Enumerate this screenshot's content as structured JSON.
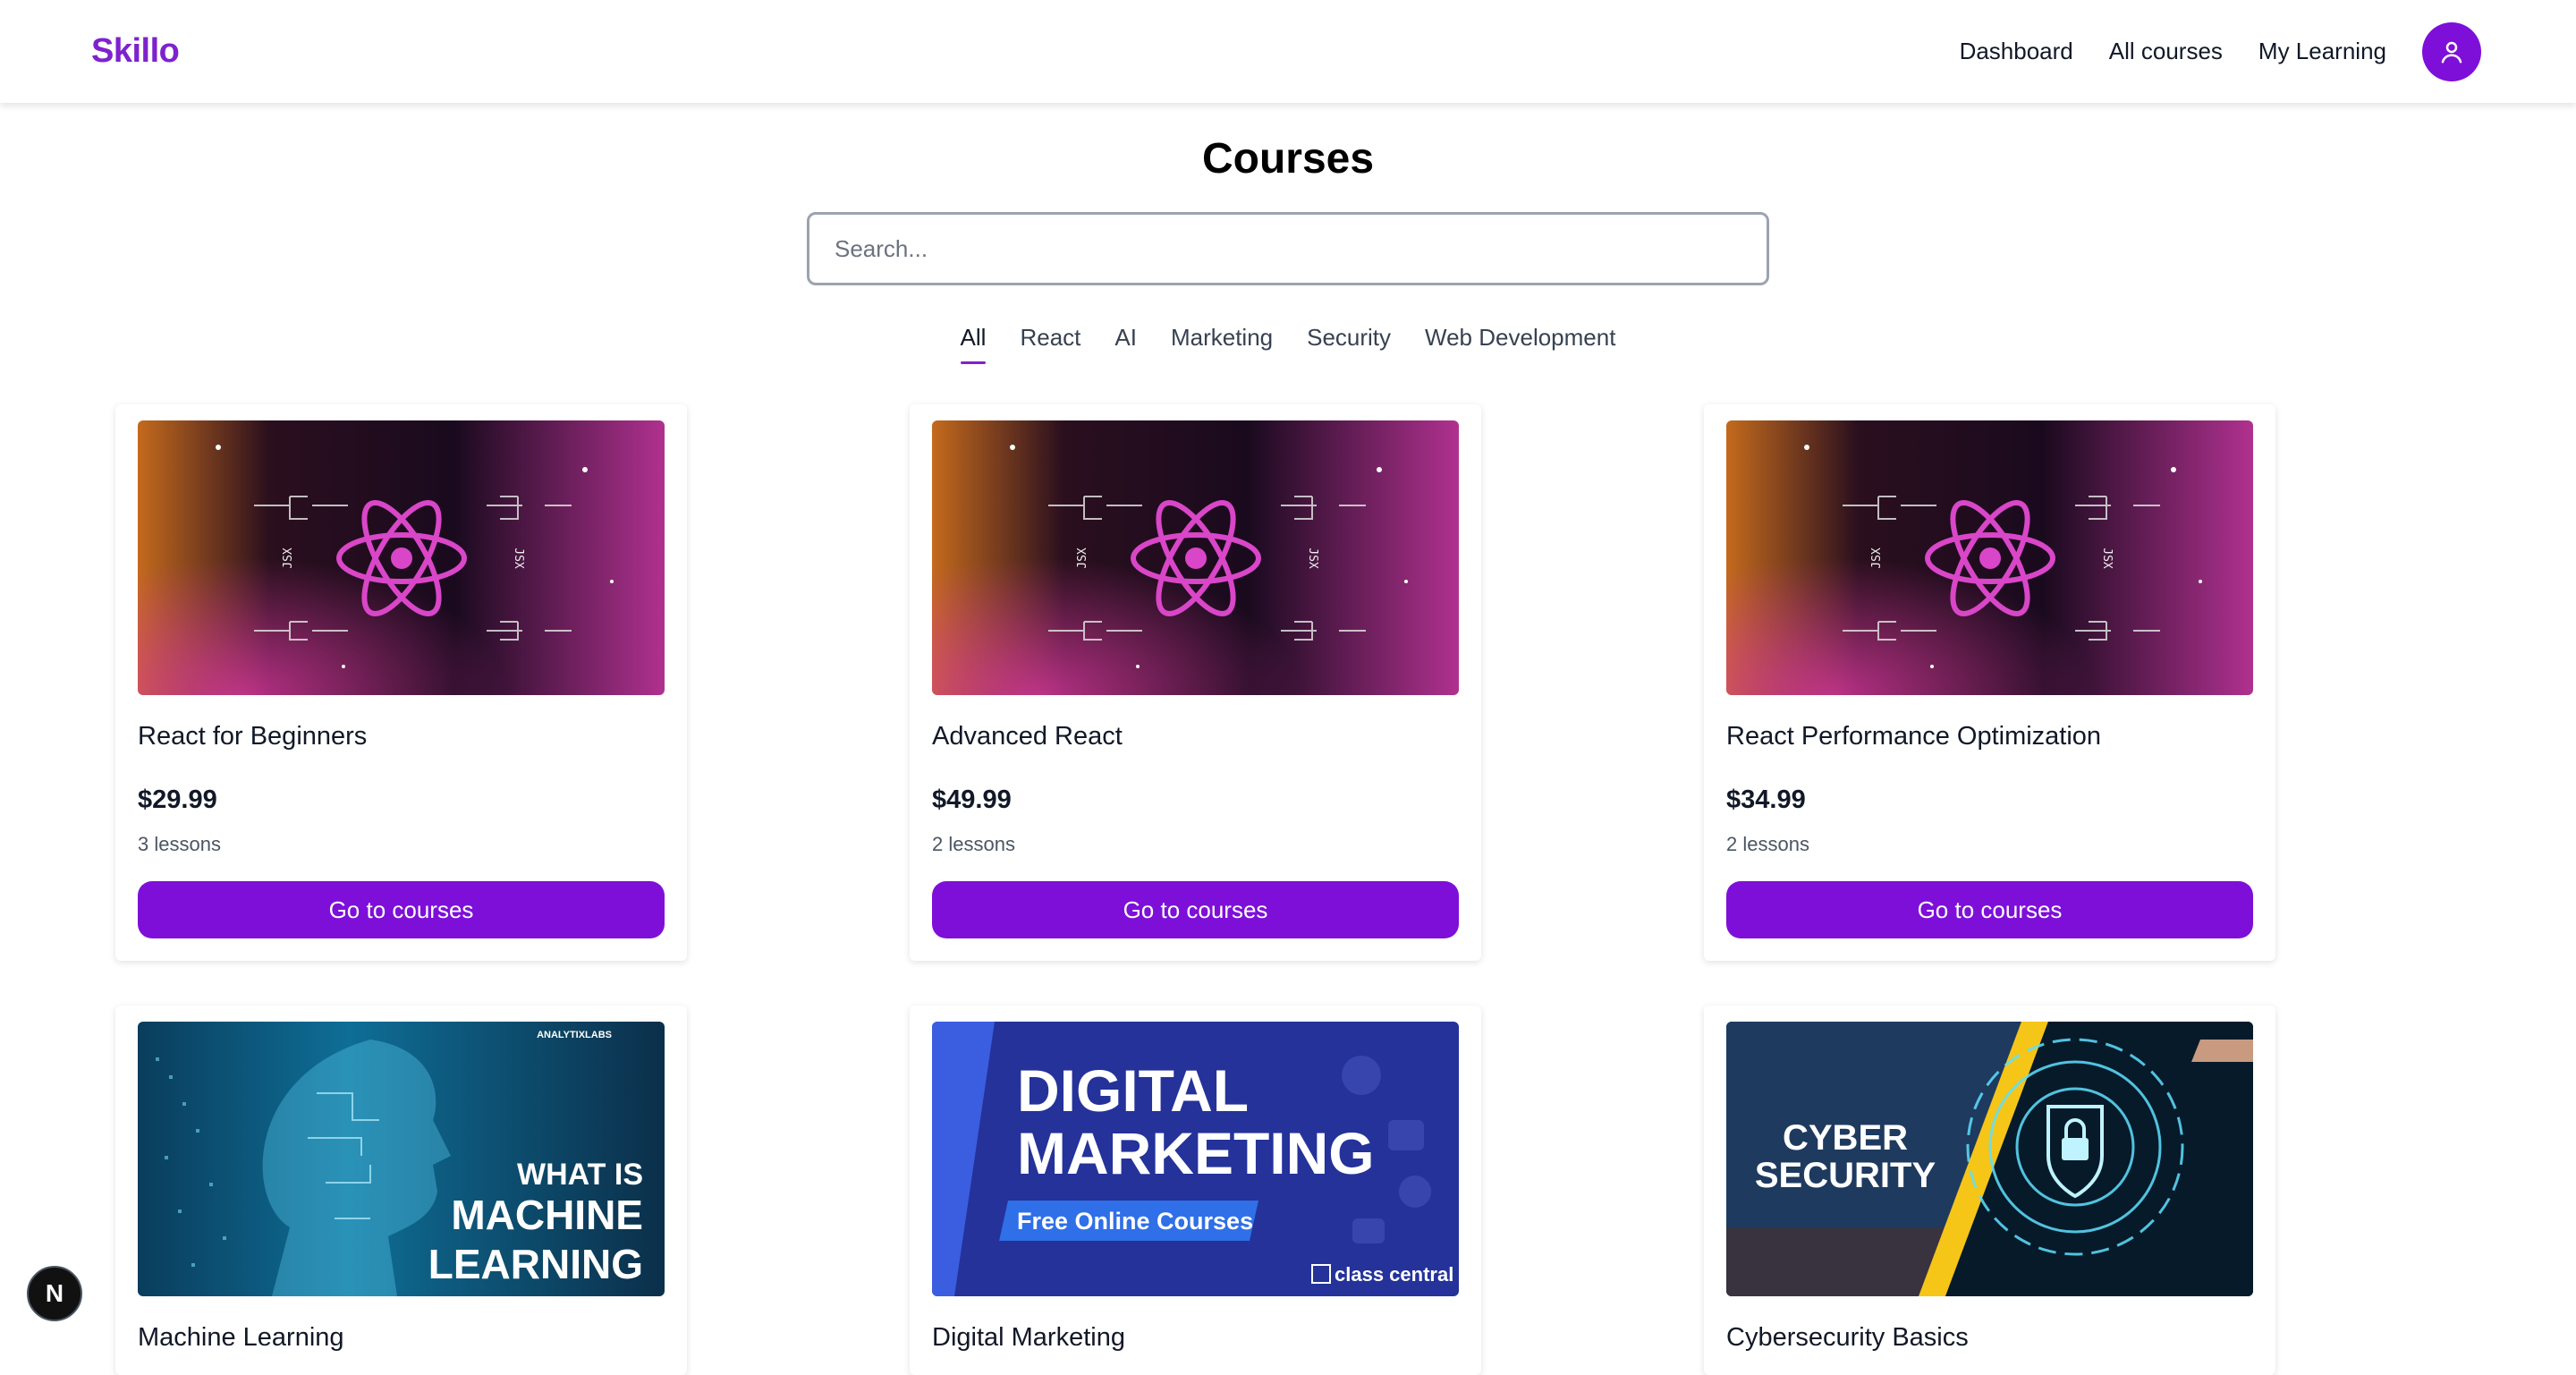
{
  "header": {
    "brand": "Skillo",
    "nav": [
      "Dashboard",
      "All courses",
      "My Learning"
    ],
    "avatar_icon": "user-icon"
  },
  "main": {
    "title": "Courses",
    "search_placeholder": "Search...",
    "tabs": [
      "All",
      "React",
      "AI",
      "Marketing",
      "Security",
      "Web Development"
    ],
    "active_tab": "All",
    "courses": [
      {
        "title": "React for Beginners",
        "price": "$29.99",
        "lessons": "3 lessons",
        "button": "Go to courses",
        "image": "react-thumbnail"
      },
      {
        "title": "Advanced React",
        "price": "$49.99",
        "lessons": "2 lessons",
        "button": "Go to courses",
        "image": "react-thumbnail"
      },
      {
        "title": "React Performance Optimization",
        "price": "$34.99",
        "lessons": "2 lessons",
        "button": "Go to courses",
        "image": "react-thumbnail"
      },
      {
        "title": "Machine Learning",
        "image": "ml-thumbnail",
        "image_text": {
          "brand": "ANALYTIXLABS",
          "line1": "WHAT IS",
          "line2": "MACHINE",
          "line3": "LEARNING"
        }
      },
      {
        "title": "Digital Marketing",
        "image": "marketing-thumbnail",
        "image_text": {
          "line1": "DIGITAL",
          "line2": "MARKETING",
          "tag": "Free Online Courses",
          "brand": "class central"
        }
      },
      {
        "title": "Cybersecurity Basics",
        "image": "cyber-thumbnail",
        "image_text": {
          "line1": "CYBER",
          "line2": "SECURITY"
        }
      }
    ]
  },
  "react_thumb_label": "JSX",
  "dev_badge": "N",
  "colors": {
    "brand": "#7e22ce",
    "button": "#7e0fd9"
  }
}
